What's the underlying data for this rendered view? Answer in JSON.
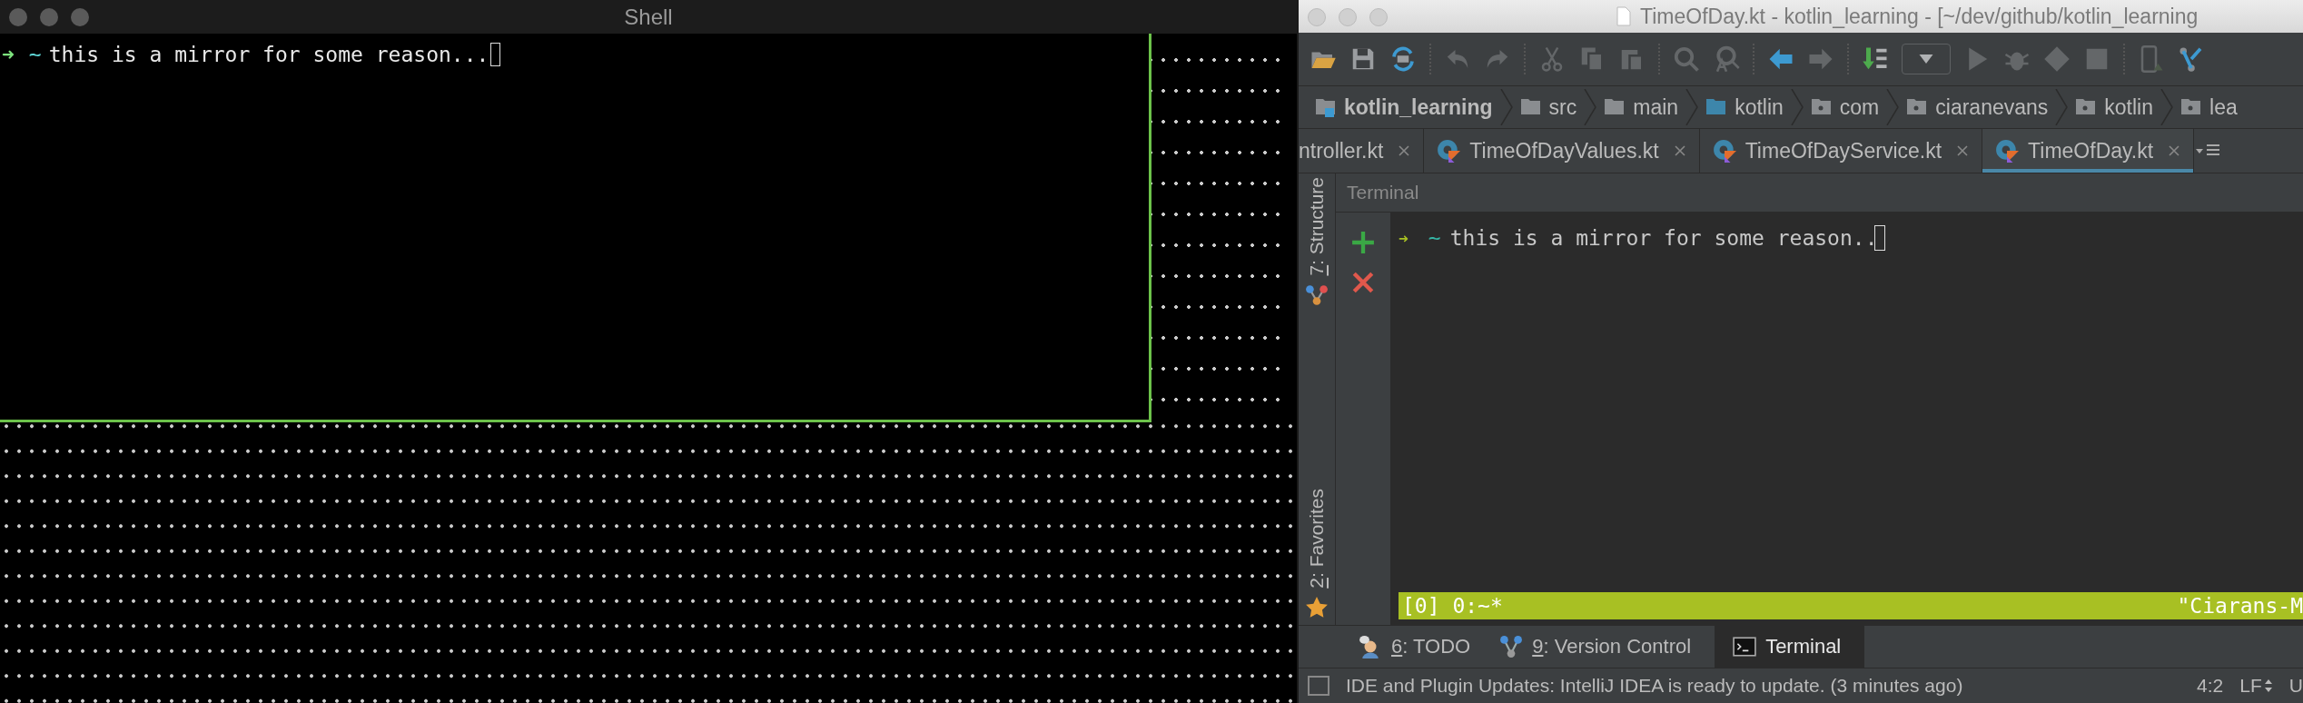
{
  "shell": {
    "title": "Shell",
    "prompt_arrow": "➜",
    "prompt_dir": "~",
    "command": "this is a mirror for some reason..."
  },
  "ide": {
    "title": "TimeOfDay.kt - kotlin_learning - [~/dev/github/kotlin_learning",
    "toolbar": [
      {
        "kind": "open",
        "disabled": false
      },
      {
        "kind": "save",
        "disabled": false
      },
      {
        "kind": "sync",
        "disabled": false
      },
      {
        "kind": "sep"
      },
      {
        "kind": "undo",
        "disabled": true
      },
      {
        "kind": "redo",
        "disabled": true
      },
      {
        "kind": "sep"
      },
      {
        "kind": "cut",
        "disabled": true
      },
      {
        "kind": "copy",
        "disabled": true
      },
      {
        "kind": "paste",
        "disabled": true
      },
      {
        "kind": "sep"
      },
      {
        "kind": "find",
        "disabled": true
      },
      {
        "kind": "replace",
        "disabled": true
      },
      {
        "kind": "sep"
      },
      {
        "kind": "back",
        "disabled": false
      },
      {
        "kind": "forward",
        "disabled": true
      },
      {
        "kind": "sep"
      },
      {
        "kind": "build",
        "disabled": false
      },
      {
        "kind": "dropdown",
        "disabled": false
      },
      {
        "kind": "run",
        "disabled": true
      },
      {
        "kind": "debug",
        "disabled": true
      },
      {
        "kind": "coverage",
        "disabled": true
      },
      {
        "kind": "stop",
        "disabled": true
      },
      {
        "kind": "sep"
      },
      {
        "kind": "device",
        "disabled": true
      },
      {
        "kind": "vcs",
        "disabled": false
      }
    ],
    "breadcrumbs": [
      {
        "label": "kotlin_learning",
        "kind": "project"
      },
      {
        "label": "src",
        "kind": "folder"
      },
      {
        "label": "main",
        "kind": "folder"
      },
      {
        "label": "kotlin",
        "kind": "source"
      },
      {
        "label": "com",
        "kind": "package"
      },
      {
        "label": "ciaranevans",
        "kind": "package"
      },
      {
        "label": "kotlin",
        "kind": "package"
      },
      {
        "label": "lea",
        "kind": "package"
      }
    ],
    "tabs": [
      {
        "label": "ntroller.kt",
        "selected": false,
        "icon": false
      },
      {
        "label": "TimeOfDayValues.kt",
        "selected": false,
        "icon": true
      },
      {
        "label": "TimeOfDayService.kt",
        "selected": false,
        "icon": true
      },
      {
        "label": "TimeOfDay.kt",
        "selected": true,
        "icon": true
      }
    ],
    "side_tools": [
      {
        "mnemonic": "7",
        "label": ": Structure",
        "kind": "structure"
      },
      {
        "mnemonic": "2",
        "label": ": Favorites",
        "kind": "favorites"
      }
    ],
    "terminal": {
      "title": "Terminal",
      "prompt_arrow": "➜",
      "prompt_dir": "~",
      "command": "this is a mirror for some reason..",
      "tmux_left": "[0] 0:~*",
      "tmux_right": "\"Ciarans-M"
    },
    "tool_tabs": [
      {
        "mnemonic": "6",
        "label": ": TODO",
        "kind": "todo",
        "selected": false
      },
      {
        "mnemonic": "9",
        "label": ": Version Control",
        "kind": "vcs",
        "selected": false
      },
      {
        "label": "Terminal",
        "kind": "terminal",
        "selected": true
      }
    ],
    "status": {
      "message": "IDE and Plugin Updates: IntelliJ IDEA is ready to update. (3 minutes ago)",
      "position": "4:2",
      "line_ending": "LF",
      "encoding": "U"
    }
  }
}
